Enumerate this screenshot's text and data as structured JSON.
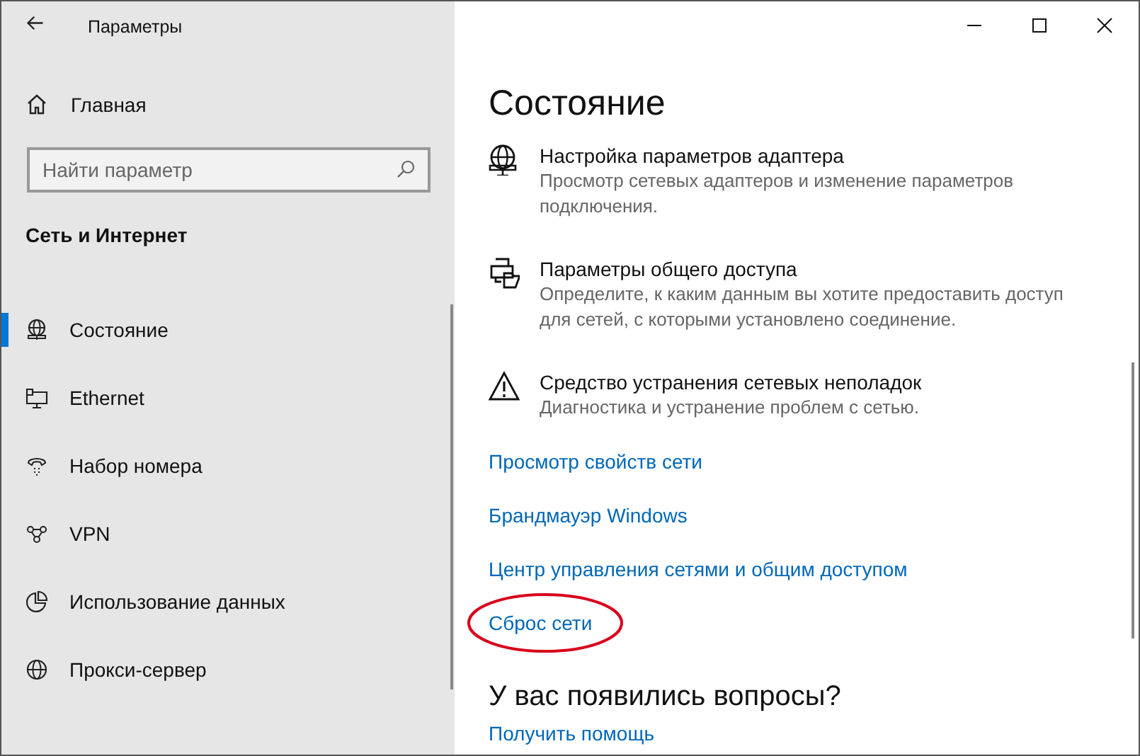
{
  "window": {
    "title": "Параметры"
  },
  "nav": {
    "home": "Главная",
    "search": {
      "placeholder": "Найти параметр"
    },
    "section": "Сеть и Интернет",
    "items": [
      {
        "label": "Состояние",
        "kind": "status",
        "selected": true
      },
      {
        "label": "Ethernet",
        "kind": "ethernet",
        "selected": false
      },
      {
        "label": "Набор номера",
        "kind": "dialup",
        "selected": false
      },
      {
        "label": "VPN",
        "kind": "vpn",
        "selected": false
      },
      {
        "label": "Использование данных",
        "kind": "data",
        "selected": false
      },
      {
        "label": "Прокси-сервер",
        "kind": "proxy",
        "selected": false
      }
    ]
  },
  "content": {
    "heading": "Состояние",
    "settings": [
      {
        "kind": "adapter",
        "title": "Настройка параметров адаптера",
        "description": "Просмотр сетевых адаптеров и изменение параметров подключения."
      },
      {
        "kind": "sharing",
        "title": "Параметры общего доступа",
        "description": "Определите, к каким данным вы хотите предоставить доступ для сетей, с которыми установлено соединение."
      },
      {
        "kind": "troubleshoot",
        "title": "Средство устранения сетевых неполадок",
        "description": "Диагностика и устранение проблем с сетью."
      }
    ],
    "links": [
      {
        "label": "Просмотр свойств сети",
        "highlighted": false
      },
      {
        "label": "Брандмауэр Windows",
        "highlighted": false
      },
      {
        "label": "Центр управления сетями и общим доступом",
        "highlighted": false
      },
      {
        "label": "Сброс сети",
        "highlighted": true
      }
    ],
    "help": {
      "heading": "У вас появились вопросы?",
      "link": "Получить помощь"
    }
  }
}
